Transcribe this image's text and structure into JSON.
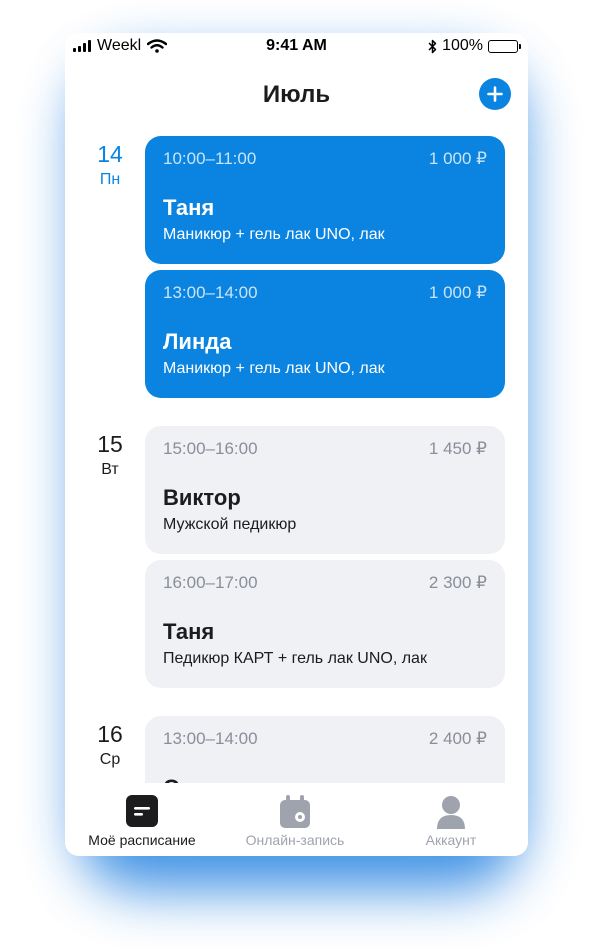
{
  "status_bar": {
    "carrier": "Weekl",
    "time": "9:41 AM",
    "battery": "100%"
  },
  "header": {
    "title": "Июль"
  },
  "days": [
    {
      "day_number": "14",
      "weekday": "Пн",
      "appointments": [
        {
          "time": "10:00–11:00",
          "price": "1 000 ₽",
          "client": "Таня",
          "service": "Маникюр + гель лак UNO, лак"
        },
        {
          "time": "13:00–14:00",
          "price": "1 000 ₽",
          "client": "Линда",
          "service": "Маникюр + гель лак UNO, лак"
        }
      ]
    },
    {
      "day_number": "15",
      "weekday": "Вт",
      "appointments": [
        {
          "time": "15:00–16:00",
          "price": "1 450 ₽",
          "client": "Виктор",
          "service": "Мужской педикюр"
        },
        {
          "time": "16:00–17:00",
          "price": "2 300 ₽",
          "client": "Таня",
          "service": "Педикюр КАРТ + гель лак UNO, лак"
        }
      ]
    },
    {
      "day_number": "16",
      "weekday": "Ср",
      "appointments": [
        {
          "time": "13:00–14:00",
          "price": "2 400 ₽",
          "client": "Ольга",
          "service": ""
        }
      ]
    }
  ],
  "tabbar": {
    "tabs": [
      {
        "label": "Моё расписание",
        "icon": "schedule-icon",
        "active": true
      },
      {
        "label": "Онлайн-запись",
        "icon": "calendar-settings-icon",
        "active": false
      },
      {
        "label": "Аккаунт",
        "icon": "account-icon",
        "active": false
      }
    ]
  },
  "colors": {
    "accent": "#0a84e0",
    "card_grey": "#f0f1f4",
    "text": "#1c1c1e",
    "muted": "#9ea3ad"
  }
}
